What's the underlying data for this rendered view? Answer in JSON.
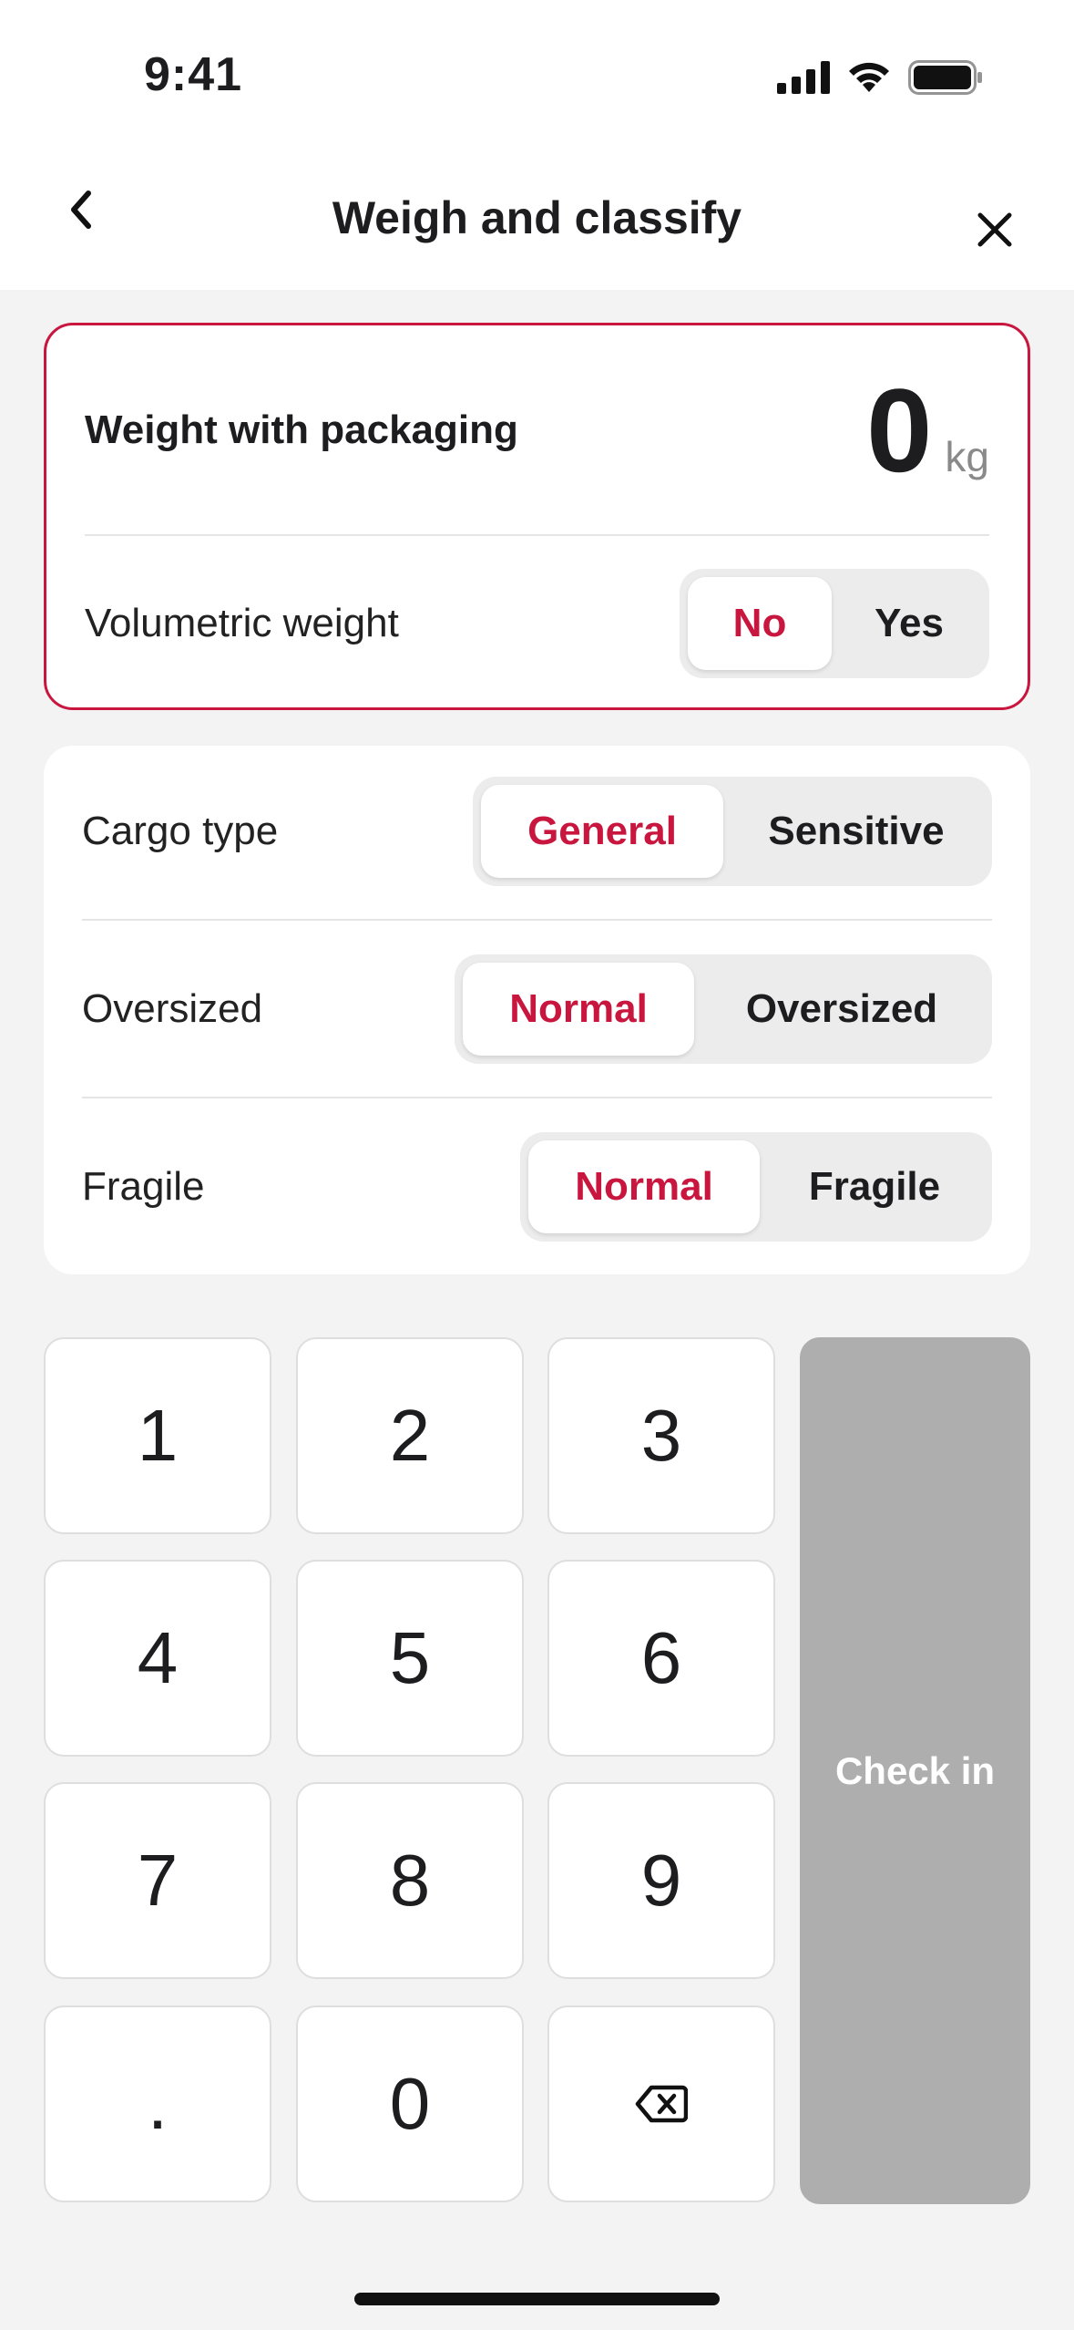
{
  "status_bar": {
    "time": "9:41"
  },
  "header": {
    "title": "Weigh and classify"
  },
  "weight_card": {
    "label": "Weight with packaging",
    "value": "0",
    "unit": "kg",
    "volumetric": {
      "label": "Volumetric weight",
      "options": [
        "No",
        "Yes"
      ],
      "selected": "No"
    }
  },
  "attributes": [
    {
      "label": "Cargo type",
      "options": [
        "General",
        "Sensitive"
      ],
      "selected": "General"
    },
    {
      "label": "Oversized",
      "options": [
        "Normal",
        "Oversized"
      ],
      "selected": "Normal"
    },
    {
      "label": "Fragile",
      "options": [
        "Normal",
        "Fragile"
      ],
      "selected": "Normal"
    }
  ],
  "keypad": {
    "keys": [
      "1",
      "2",
      "3",
      "4",
      "5",
      "6",
      "7",
      "8",
      "9",
      ".",
      "0"
    ],
    "backspace_icon": "backspace-icon",
    "checkin_label": "Check in"
  },
  "colors": {
    "accent": "#c8163f",
    "disabled_button": "#aeaeae",
    "background": "#f3f3f3"
  }
}
